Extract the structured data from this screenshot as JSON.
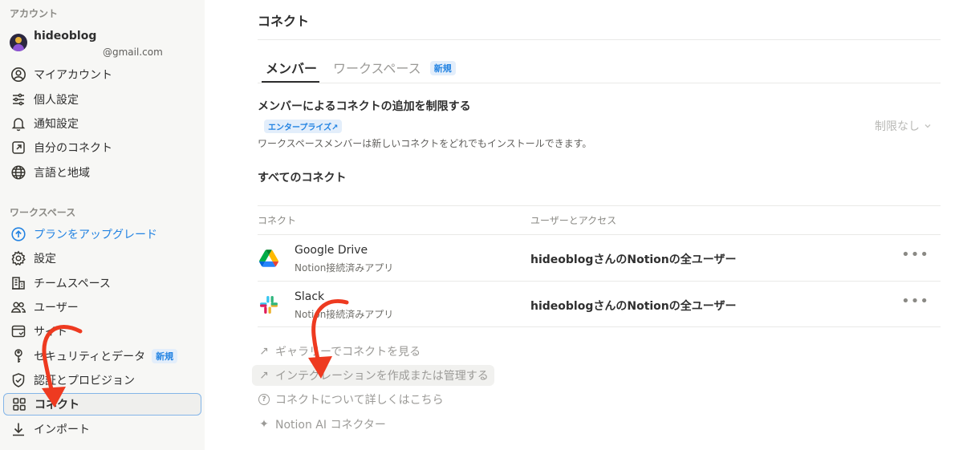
{
  "sidebar": {
    "account_label": "アカウント",
    "account_name": "hideoblog",
    "account_email": "@gmail.com",
    "account_items": [
      {
        "label": "マイアカウント",
        "icon": "user-circle-icon"
      },
      {
        "label": "個人設定",
        "icon": "sliders-icon"
      },
      {
        "label": "通知設定",
        "icon": "bell-icon"
      },
      {
        "label": "自分のコネクト",
        "icon": "arrow-square-icon"
      },
      {
        "label": "言語と地域",
        "icon": "globe-icon"
      }
    ],
    "workspace_label": "ワークスペース",
    "workspace_items": [
      {
        "label": "プランをアップグレード",
        "icon": "upgrade-arrow-icon"
      },
      {
        "label": "設定",
        "icon": "gear-icon"
      },
      {
        "label": "チームスペース",
        "icon": "building-icon"
      },
      {
        "label": "ユーザー",
        "icon": "users-icon"
      },
      {
        "label": "サイト",
        "icon": "browser-window-icon"
      },
      {
        "label": "セキュリティとデータ",
        "icon": "key-icon",
        "badge": "新規"
      },
      {
        "label": "認証とプロビジョン",
        "icon": "shield-check-icon"
      },
      {
        "label": "コネクト",
        "icon": "grid-icon"
      },
      {
        "label": "インポート",
        "icon": "download-arrow-icon"
      }
    ]
  },
  "main": {
    "title": "コネクト",
    "tabs": [
      {
        "label": "メンバー"
      },
      {
        "label": "ワークスペース",
        "badge": "新規"
      }
    ],
    "restrict": {
      "title": "メンバーによるコネクトの追加を制限する",
      "badge": "エンタープライズ↗",
      "description": "ワークスペースメンバーは新しいコネクトをどれでもインストールできます。",
      "select_value": "制限なし"
    },
    "all_title": "すべてのコネクト",
    "table": {
      "headers": [
        "コネクト",
        "ユーザーとアクセス"
      ],
      "rows": [
        {
          "name": "Google Drive",
          "sub": "Notion接続済みアプリ",
          "access": "hideoblogさんのNotionの全ユーザー",
          "icon": "google-drive-icon",
          "more": "•••"
        },
        {
          "name": "Slack",
          "sub": "Notion接続済みアプリ",
          "access": "hideoblogさんのNotionの全ユーザー",
          "icon": "slack-icon",
          "more": "•••"
        }
      ]
    },
    "links": [
      {
        "label": "ギャラリーでコネクトを見る",
        "icon": "arrow-up-right-icon",
        "glyph": "↗"
      },
      {
        "label": "インテグレーションを作成または管理する",
        "icon": "arrow-up-right-icon",
        "glyph": "↗"
      },
      {
        "label": "コネクトについて詳しくはこちら",
        "icon": "question-circle-icon",
        "glyph": "?"
      },
      {
        "label": "Notion AI コネクター",
        "icon": "sparkle-icon",
        "glyph": "✦"
      }
    ]
  },
  "colors": {
    "accent": "#2383e2",
    "annotation_arrow": "#ee3a20",
    "sidebar_bg": "#f7f7f5"
  }
}
